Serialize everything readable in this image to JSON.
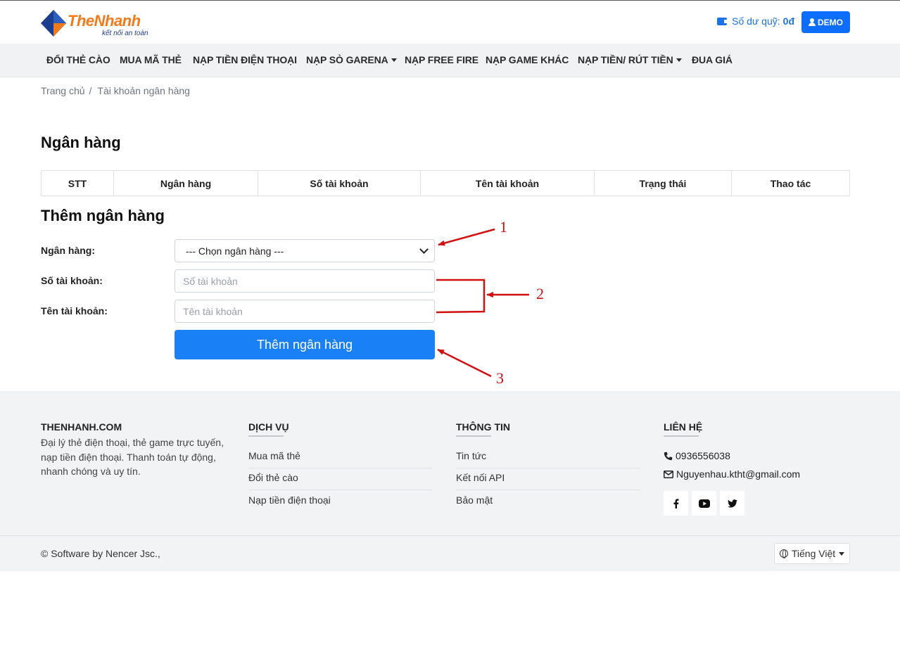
{
  "brand": {
    "name_part1": "The",
    "name_part2": "Nhanh",
    "tagline": "kết nối an toàn"
  },
  "header": {
    "balance_label": "Số dư quỹ:",
    "balance_value": "0đ",
    "user_button": "DEMO"
  },
  "nav": [
    {
      "label": "ĐỔI THẺ CÀO",
      "dropdown": false
    },
    {
      "label": "MUA MÃ THẺ",
      "dropdown": false
    },
    {
      "label": "NẠP TIỀN ĐIỆN THOẠI",
      "dropdown": false
    },
    {
      "label": "NẠP SÒ GARENA",
      "dropdown": true
    },
    {
      "label": "NẠP FREE FIRE",
      "dropdown": false
    },
    {
      "label": "NẠP GAME KHÁC",
      "dropdown": false
    },
    {
      "label": "NẠP TIỀN/ RÚT TIỀN",
      "dropdown": true
    },
    {
      "label": "ĐUA GIÁ",
      "dropdown": false
    }
  ],
  "breadcrumb": {
    "home": "Trang chủ",
    "separator": "/",
    "current": "Tài khoản ngân hàng"
  },
  "bank_section": {
    "title": "Ngân hàng",
    "columns": [
      "STT",
      "Ngân hàng",
      "Số tài khoản",
      "Tên tài khoản",
      "Trạng thái",
      "Thao tác"
    ]
  },
  "add_form": {
    "title": "Thêm ngân hàng",
    "bank_label": "Ngân hàng:",
    "bank_select_value": "--- Chọn ngân hàng ---",
    "account_number_label": "Số tài khoản:",
    "account_number_placeholder": "Số tài khoản",
    "account_name_label": "Tên tài khoản:",
    "account_name_placeholder": "Tên tài khoản",
    "submit_label": "Thêm ngân hàng"
  },
  "annotations": {
    "color": "#d11010",
    "marks": [
      "1",
      "2",
      "3"
    ]
  },
  "footer": {
    "about": {
      "title": "THENHANH.COM",
      "description": "Đại lý thẻ điện thoại, thẻ game trực tuyến, nạp tiền điện thoại. Thanh toán tự động, nhanh chóng và uy tín."
    },
    "services": {
      "title": "DỊCH VỤ",
      "links": [
        "Mua mã thẻ",
        "Đổi thẻ cào",
        "Nạp tiền điện thoại"
      ]
    },
    "info": {
      "title": "THÔNG TIN",
      "links": [
        "Tin tức",
        "Kết nối API",
        "Bảo mật"
      ]
    },
    "contact": {
      "title": "LIÊN HỆ",
      "phone": "0936556038",
      "email": "Nguyenhau.ktht@gmail.com",
      "socials": [
        "facebook-icon",
        "youtube-icon",
        "twitter-icon"
      ]
    }
  },
  "bottom_bar": {
    "copyright": "© Software by Nencer Jsc.,",
    "language": "Tiếng Việt"
  },
  "colors": {
    "primary": "#1a80f6",
    "brand_orange": "#f07a1c",
    "brand_blue": "#1b3e8f"
  }
}
